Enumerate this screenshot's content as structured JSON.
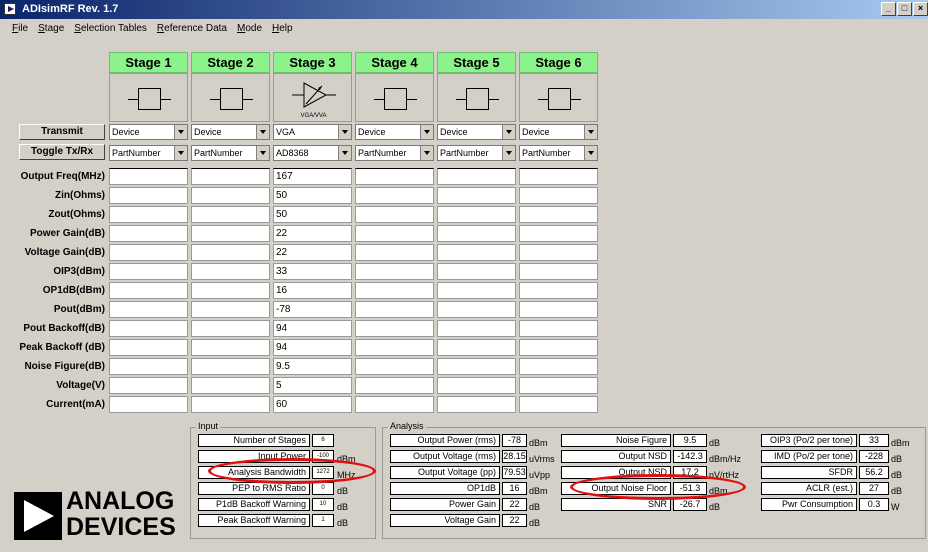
{
  "window": {
    "title": "ADIsimRF Rev. 1.7"
  },
  "menu": [
    "File",
    "Stage",
    "Selection Tables",
    "Reference Data",
    "Mode",
    "Help"
  ],
  "stages": [
    {
      "name": "Stage 1",
      "device": "Device",
      "part": "PartNumber",
      "icon": "block"
    },
    {
      "name": "Stage 2",
      "device": "Device",
      "part": "PartNumber",
      "icon": "block"
    },
    {
      "name": "Stage 3",
      "device": "VGA",
      "part": "AD8368",
      "icon": "vga",
      "icon_label": "VGA/VVA"
    },
    {
      "name": "Stage 4",
      "device": "Device",
      "part": "PartNumber",
      "icon": "block"
    },
    {
      "name": "Stage 5",
      "device": "Device",
      "part": "PartNumber",
      "icon": "block"
    },
    {
      "name": "Stage 6",
      "device": "Device",
      "part": "PartNumber",
      "icon": "block"
    }
  ],
  "controls": {
    "transmit": "Transmit",
    "toggle": "Toggle Tx/Rx"
  },
  "params": [
    {
      "label": "Output Freq(MHz)",
      "stage3": "167"
    },
    {
      "label": "Zin(Ohms)",
      "stage3": "50"
    },
    {
      "label": "Zout(Ohms)",
      "stage3": "50"
    },
    {
      "label": "Power Gain(dB)",
      "stage3": "22"
    },
    {
      "label": "Voltage Gain(dB)",
      "stage3": "22"
    },
    {
      "label": "OIP3(dBm)",
      "stage3": "33"
    },
    {
      "label": "OP1dB(dBm)",
      "stage3": "16"
    },
    {
      "label": "Pout(dBm)",
      "stage3": "-78"
    },
    {
      "label": "Pout Backoff(dB)",
      "stage3": "94"
    },
    {
      "label": "Peak Backoff (dB)",
      "stage3": "94"
    },
    {
      "label": "Noise Figure(dB)",
      "stage3": "9.5"
    },
    {
      "label": "Voltage(V)",
      "stage3": "5"
    },
    {
      "label": "Current(mA)",
      "stage3": "60"
    }
  ],
  "input_panel": {
    "title": "Input",
    "rows": [
      {
        "label": "Number of Stages",
        "value": "6",
        "unit": ""
      },
      {
        "label": "Input Power",
        "value": "-100",
        "unit": "dBm"
      },
      {
        "label": "Analysis Bandwidth",
        "value": "1272",
        "unit": "MHz"
      },
      {
        "label": "PEP to RMS Ratio",
        "value": "0",
        "unit": "dB"
      },
      {
        "label": "P1dB Backoff Warning",
        "value": "10",
        "unit": "dB"
      },
      {
        "label": "Peak Backoff Warning",
        "value": "1",
        "unit": "dB"
      }
    ]
  },
  "analysis_panel": {
    "title": "Analysis",
    "col1": [
      {
        "label": "Output Power (rms)",
        "value": "-78",
        "unit": "dBm"
      },
      {
        "label": "Output Voltage (rms)",
        "value": "28.15",
        "unit": "uVrms"
      },
      {
        "label": "Output Voltage (pp)",
        "value": "79.53",
        "unit": "uVpp"
      },
      {
        "label": "OP1dB",
        "value": "16",
        "unit": "dBm"
      },
      {
        "label": "Power Gain",
        "value": "22",
        "unit": "dB"
      },
      {
        "label": "Voltage Gain",
        "value": "22",
        "unit": "dB"
      }
    ],
    "col2": [
      {
        "label": "Noise Figure",
        "value": "9.5",
        "unit": "dB"
      },
      {
        "label": "Output NSD",
        "value": "-142.3",
        "unit": "dBm/Hz"
      },
      {
        "label": "Output NSD",
        "value": "17.2",
        "unit": "nV/rtHz"
      },
      {
        "label": "Output Noise Floor",
        "value": "-51.3",
        "unit": "dBm"
      },
      {
        "label": "SNR",
        "value": "-26.7",
        "unit": "dB"
      }
    ],
    "col3": [
      {
        "label": "OIP3 (Po/2 per tone)",
        "value": "33",
        "unit": "dBm"
      },
      {
        "label": "IMD (Po/2 per tone)",
        "value": "-228",
        "unit": "dB"
      },
      {
        "label": "SFDR",
        "value": "56.2",
        "unit": "dB"
      },
      {
        "label": "ACLR (est.)",
        "value": "27",
        "unit": "dB"
      },
      {
        "label": "Pwr Consumption",
        "value": "0.3",
        "unit": "W"
      }
    ]
  },
  "logo": {
    "line1": "ANALOG",
    "line2": "DEVICES"
  },
  "colors": {
    "stage_header": "#8cf28c",
    "highlight": "#e01010",
    "titlebar": "#0a246a"
  }
}
